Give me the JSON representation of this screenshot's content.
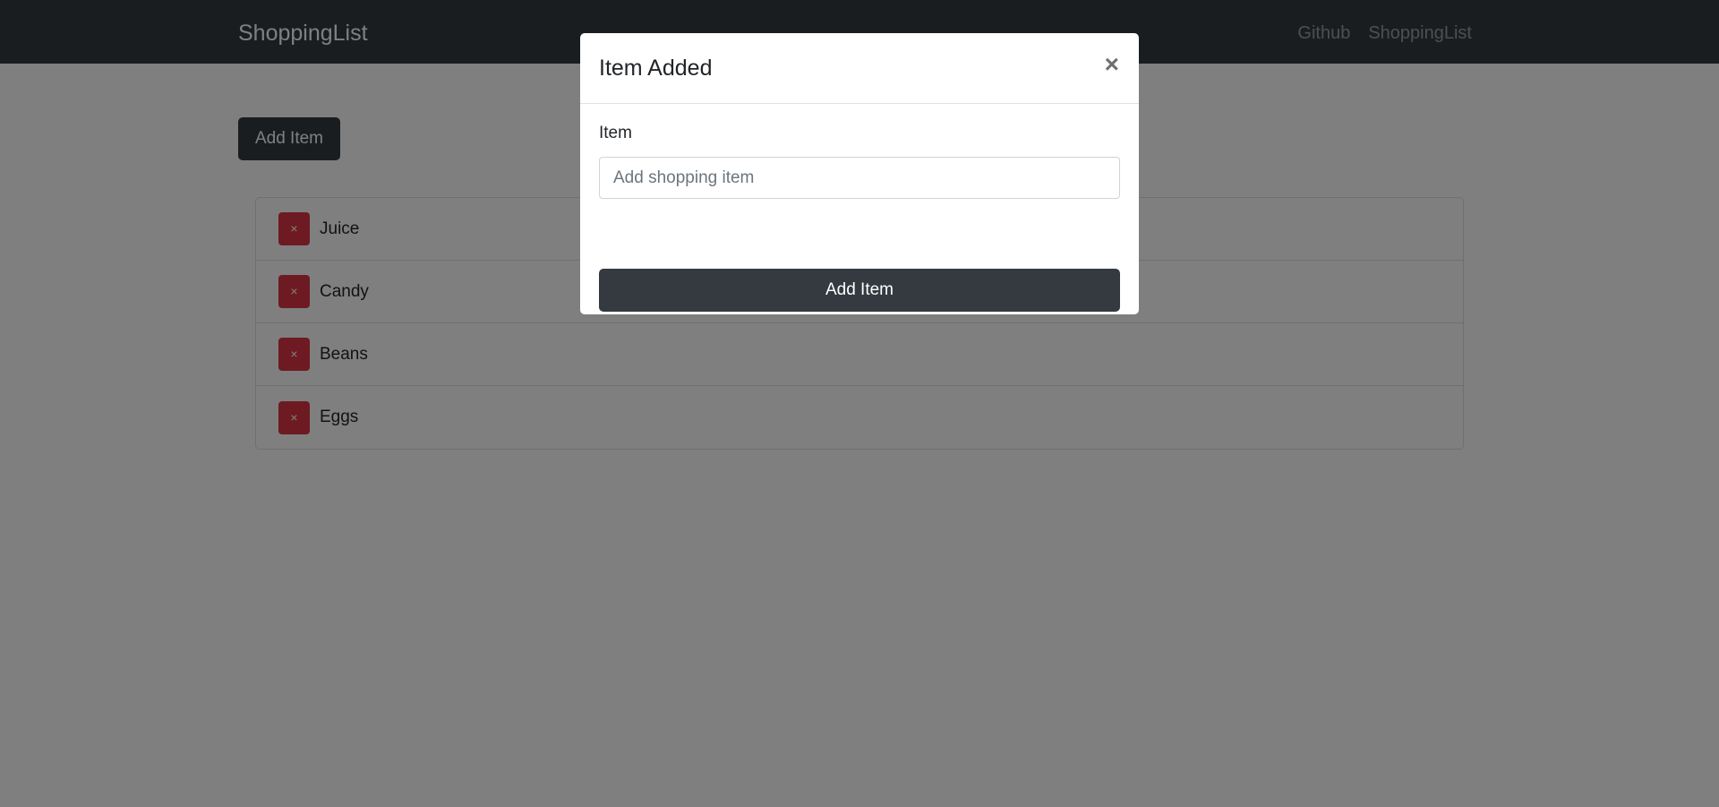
{
  "navbar": {
    "brand": "ShoppingList",
    "links": [
      "Github",
      "ShoppingList"
    ]
  },
  "main": {
    "add_button_label": "Add Item",
    "remove_symbol": "×",
    "items": [
      "Juice",
      "Candy",
      "Beans",
      "Eggs"
    ]
  },
  "modal": {
    "title": "Item Added",
    "close_symbol": "×",
    "field_label": "Item",
    "input_placeholder": "Add shopping item",
    "input_value": "",
    "submit_label": "Add Item"
  },
  "colors": {
    "navbar": "#343a40",
    "danger": "#dc3545",
    "dark_button": "#343a40"
  }
}
